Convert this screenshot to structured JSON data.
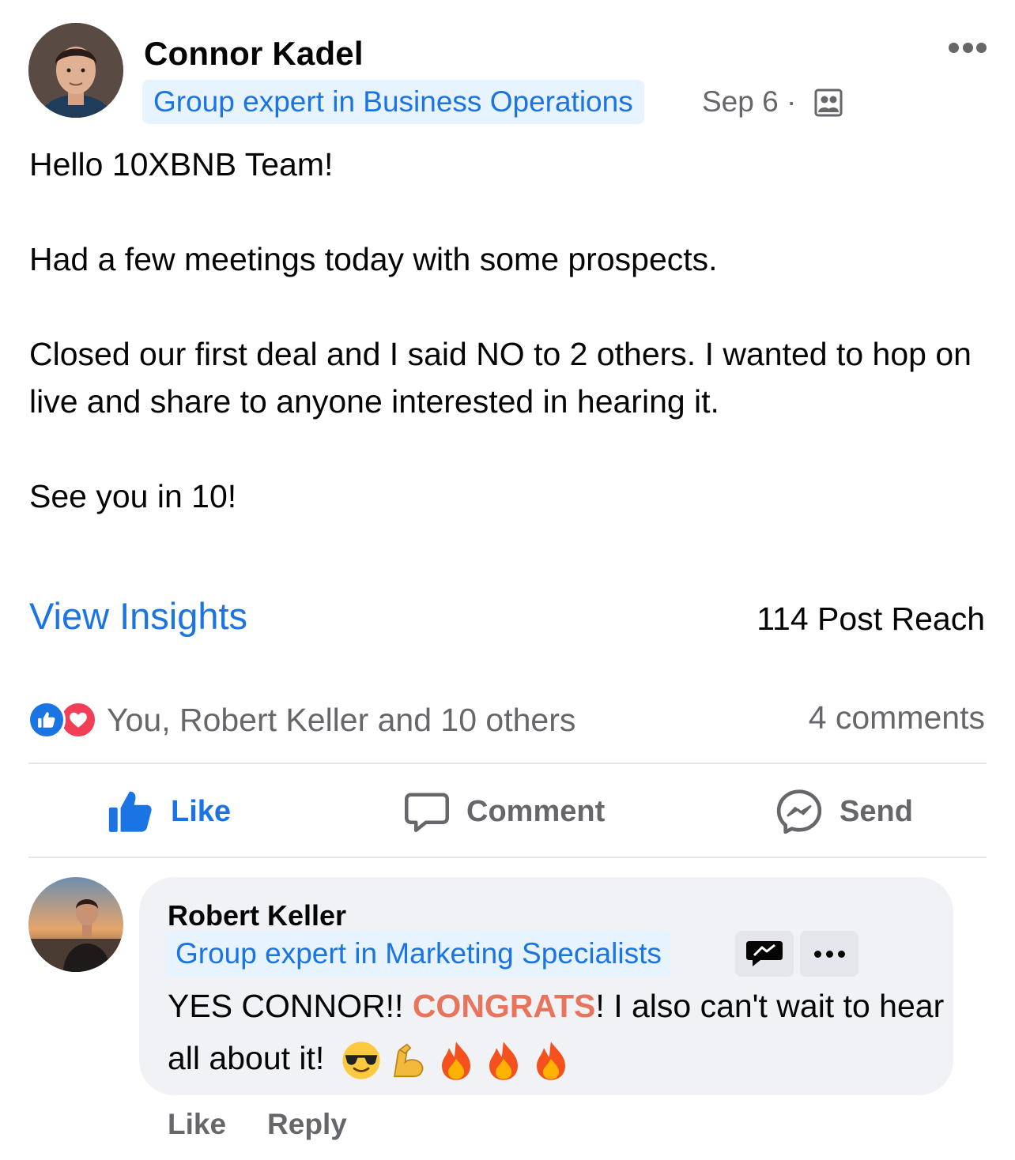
{
  "post": {
    "author": "Connor Kadel",
    "badge": "Group expert in Business Operations",
    "meta": "Sep 6 ·",
    "audience_icon": "group-audience-icon",
    "more_icon": "more-horizontal-icon",
    "paragraphs": [
      "Hello 10XBNB Team!",
      "Had a few meetings today with some prospects.",
      "Closed our first deal and I said NO to 2 others. I wanted to hop on live and share to anyone interested in hearing it.",
      "See you in 10!"
    ],
    "view_insights": "View Insights",
    "post_reach": "114 Post Reach",
    "reactions": {
      "icons": [
        "like-reaction-icon",
        "love-reaction-icon"
      ],
      "names": "You, Robert Keller and 10 others"
    },
    "comment_count": "4 comments",
    "actions": {
      "like": "Like",
      "comment": "Comment",
      "send": "Send"
    }
  },
  "comment": {
    "author": "Robert Keller",
    "badge": "Group expert in Marketing Specialists",
    "rising_icon": "rising-contributor-icon",
    "text_before": "YES CONNOR!! ",
    "text_highlight": "CONGRATS",
    "text_after": "! I also can't wait to hear all about it!",
    "emojis": [
      "sunglasses-emoji",
      "flexed-biceps-emoji",
      "fire-emoji",
      "fire-emoji",
      "fire-emoji"
    ],
    "actions": {
      "like": "Like",
      "reply": "Reply"
    }
  },
  "colors": {
    "accent": "#1b74e4",
    "secondary_text": "#65676b",
    "highlight": "#e9745c",
    "bubble": "#f0f2f5",
    "badge_bg": "#e7f3ff"
  }
}
